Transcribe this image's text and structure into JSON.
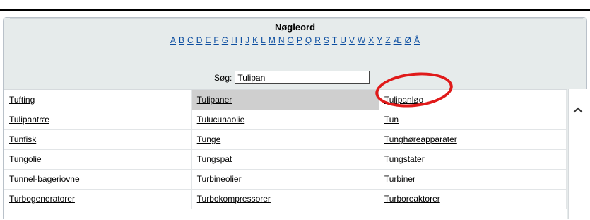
{
  "panel": {
    "title": "Nøgleord",
    "alphabet": [
      "A",
      "B",
      "C",
      "D",
      "E",
      "F",
      "G",
      "H",
      "I",
      "J",
      "K",
      "L",
      "M",
      "N",
      "O",
      "P",
      "Q",
      "R",
      "S",
      "T",
      "U",
      "V",
      "W",
      "X",
      "Y",
      "Z",
      "Æ",
      "Ø",
      "Å"
    ]
  },
  "search": {
    "label": "Søg:",
    "value": "Tulipan"
  },
  "keywords": [
    [
      "Tufting",
      "Tulipaner",
      "Tulipanløg"
    ],
    [
      "Tulipantræ",
      "Tulucunaolie",
      "Tun"
    ],
    [
      "Tunfisk",
      "Tunge",
      "Tunghøreapparater"
    ],
    [
      "Tungolie",
      "Tungspat",
      "Tungstater"
    ],
    [
      "Tunnel-bageriovne",
      "Turbineolier",
      "Turbiner"
    ],
    [
      "Turbogeneratorer",
      "Turbokompressorer",
      "Turboreaktorer"
    ]
  ],
  "selected_keyword": "Tulipaner",
  "annotation": {
    "color": "#e01a1a"
  },
  "icons": {
    "scroll_up": "chevron-up-icon"
  }
}
